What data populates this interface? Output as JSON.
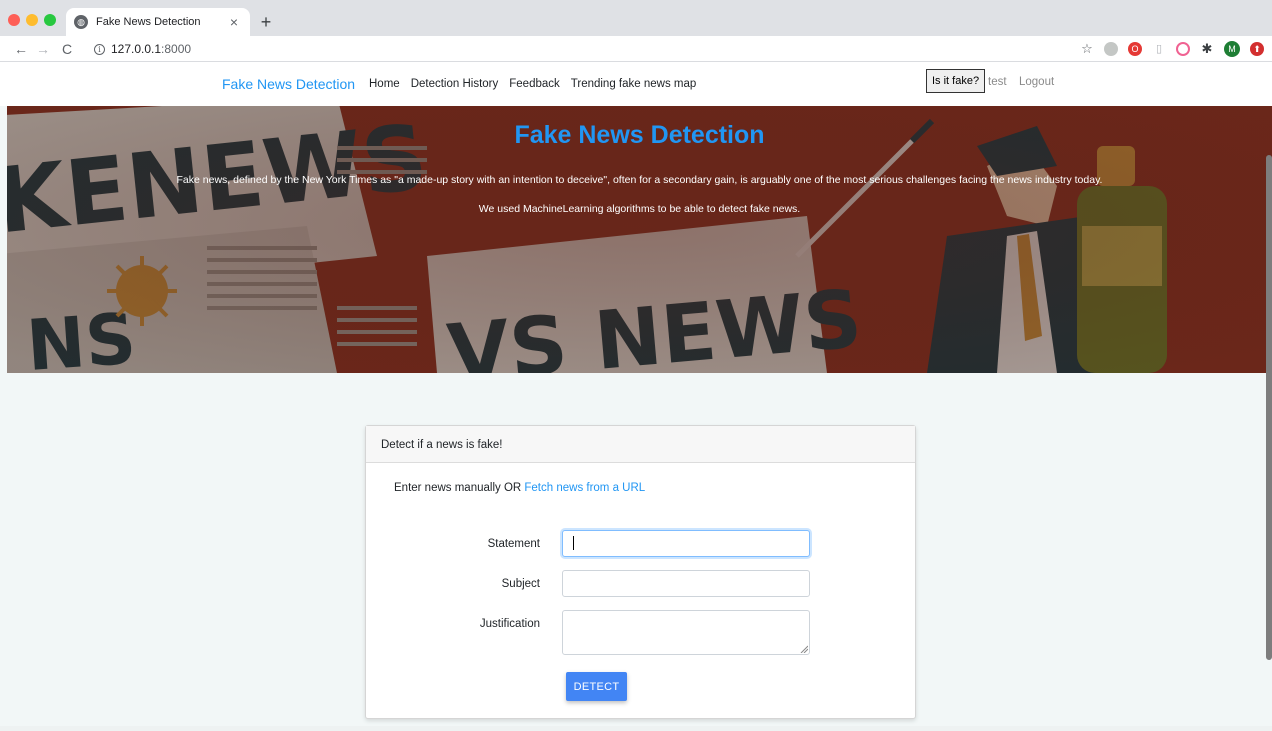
{
  "browser": {
    "tab_title": "Fake News Detection",
    "tab_close": "×",
    "new_tab": "+",
    "url_host": "127.0.0.1",
    "url_port": ":8000",
    "icons": [
      "back-arrow-icon",
      "forward-arrow-icon",
      "reload-icon",
      "info-icon",
      "bookmark-star-icon",
      "extension-icons",
      "puzzle-icon",
      "profile-avatar-icon"
    ],
    "avatar_letter": "M"
  },
  "navbar": {
    "brand": "Fake News Detection",
    "links": [
      "Home",
      "Detection History",
      "Feedback",
      "Trending fake news map"
    ],
    "is_it_fake": "Is it fake?",
    "user": "test",
    "logout": "Logout"
  },
  "hero": {
    "title": "Fake News Detection",
    "paragraph1": "Fake news, defined by the New York Times as \"a made-up story with an intention to deceive\", often for a secondary gain, is arguably one of the most serious challenges facing the news industry today.",
    "paragraph2": "We used MachineLearning algorithms to be able to detect fake news."
  },
  "card": {
    "header": "Detect if a news is fake!",
    "intro_text": "Enter news manually OR ",
    "intro_link": "Fetch news from a URL",
    "labels": {
      "statement": "Statement",
      "subject": "Subject",
      "justification": "Justification"
    },
    "values": {
      "statement": "",
      "subject": "",
      "justification": ""
    },
    "detect_button": "DETECT"
  },
  "colors": {
    "brand_blue": "#2196f3",
    "button_blue": "#4285f4",
    "hero_bg": "#7a2b1e",
    "page_bg": "#f2f7f7"
  }
}
